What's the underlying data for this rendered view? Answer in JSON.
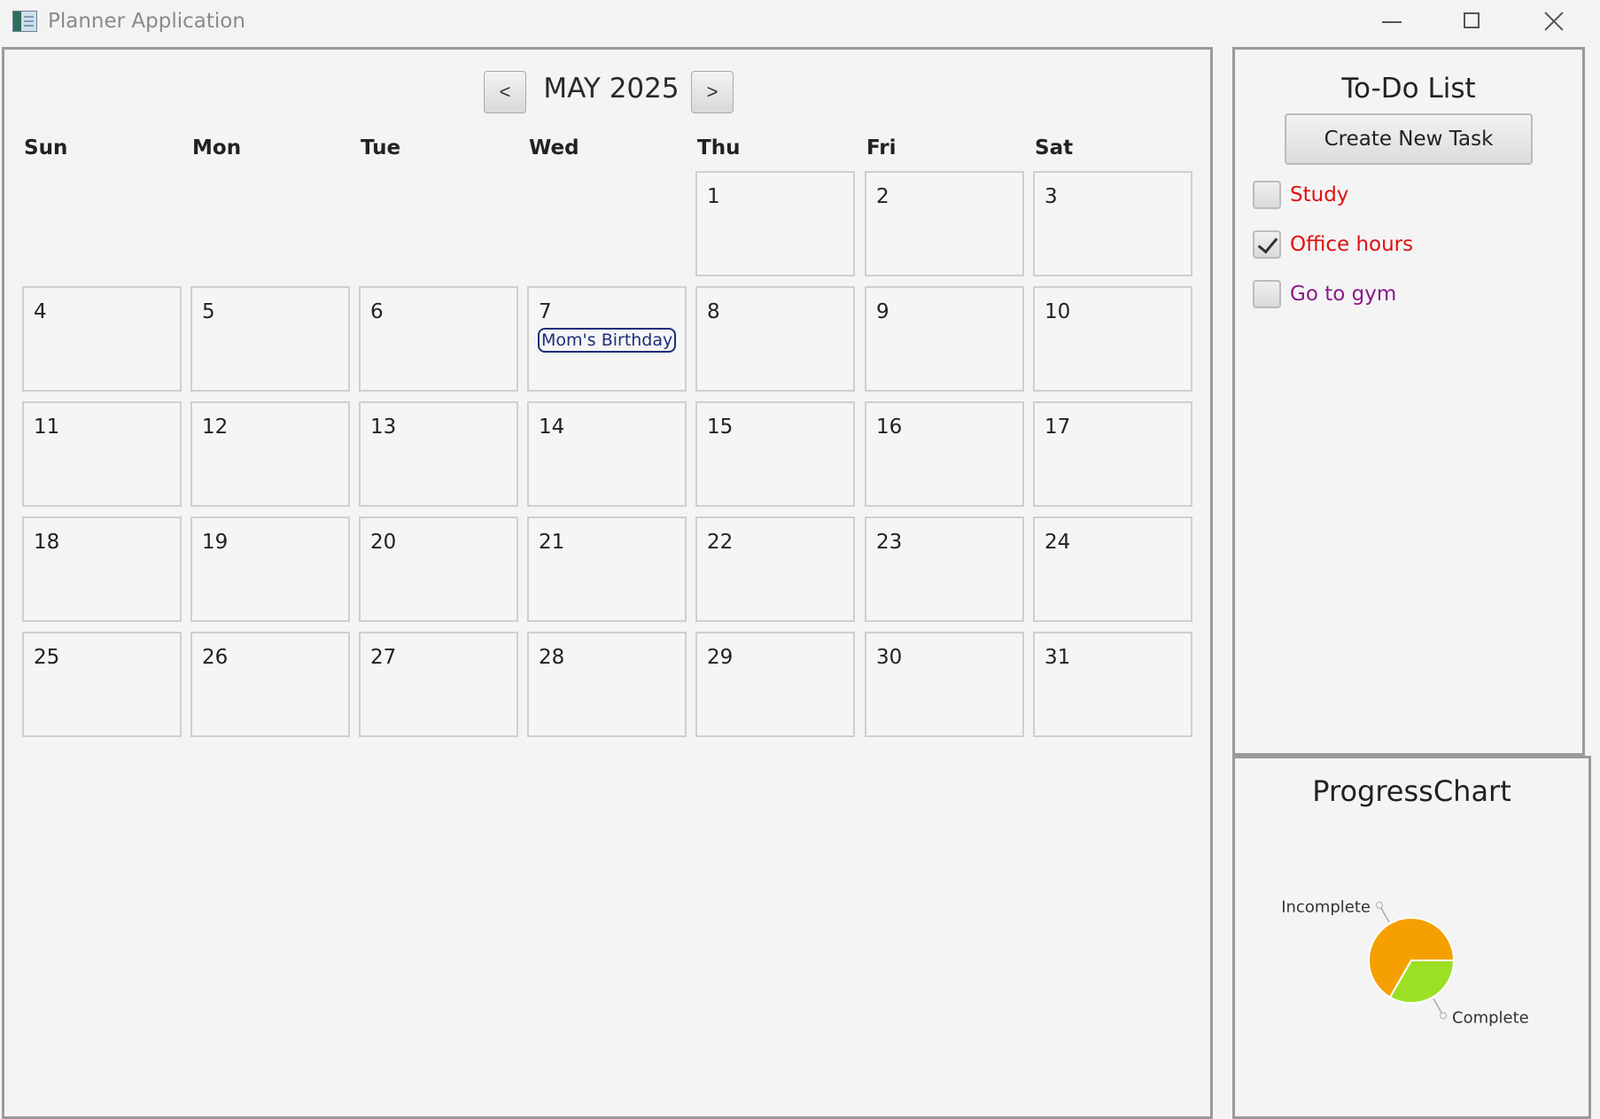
{
  "window": {
    "title": "Planner Application"
  },
  "calendar": {
    "month_title": "MAY 2025",
    "prev_label": "<",
    "next_label": ">",
    "weekdays": [
      "Sun",
      "Mon",
      "Tue",
      "Wed",
      "Thu",
      "Fri",
      "Sat"
    ],
    "weeks": [
      [
        "",
        "",
        "",
        "",
        "1",
        "2",
        "3"
      ],
      [
        "4",
        "5",
        "6",
        "7",
        "8",
        "9",
        "10"
      ],
      [
        "11",
        "12",
        "13",
        "14",
        "15",
        "16",
        "17"
      ],
      [
        "18",
        "19",
        "20",
        "21",
        "22",
        "23",
        "24"
      ],
      [
        "25",
        "26",
        "27",
        "28",
        "29",
        "30",
        "31"
      ]
    ],
    "events": [
      {
        "day": "7",
        "title": "Mom's Birthday",
        "color": "#1c2e7a"
      }
    ]
  },
  "todo": {
    "title": "To-Do List",
    "create_button": "Create New Task",
    "tasks": [
      {
        "label": "Study",
        "checked": false,
        "color": "#e01010"
      },
      {
        "label": "Office hours",
        "checked": true,
        "color": "#e01010"
      },
      {
        "label": "Go to gym",
        "checked": false,
        "color": "#8a1a8a"
      }
    ]
  },
  "chart": {
    "title": "ProgressChart",
    "chart_data": {
      "type": "pie",
      "slices": [
        {
          "label": "Incomplete",
          "value": 2,
          "color": "#f5a000"
        },
        {
          "label": "Complete",
          "value": 1,
          "color": "#9be025"
        }
      ]
    }
  }
}
